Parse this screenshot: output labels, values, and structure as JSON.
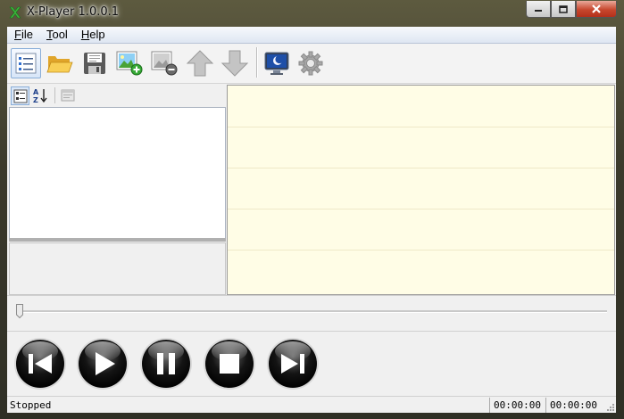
{
  "window": {
    "title": "X-Player 1.0.0.1",
    "minimize_icon": "minimize-icon",
    "maximize_icon": "maximize-icon",
    "close_icon": "close-icon"
  },
  "menu": {
    "items": [
      {
        "accel": "F",
        "rest": "ile"
      },
      {
        "accel": "T",
        "rest": "ool"
      },
      {
        "accel": "H",
        "rest": "elp"
      }
    ]
  },
  "toolbar": {
    "icons": [
      "playlist-icon",
      "open-folder-icon",
      "save-icon",
      "add-image-icon",
      "remove-image-icon",
      "move-up-icon",
      "move-down-icon",
      "display-icon",
      "settings-icon"
    ]
  },
  "left_toolbar": {
    "icons": [
      "categorized-icon",
      "sort-alpha-icon",
      "property-pages-icon"
    ]
  },
  "controls": {
    "icons": [
      "previous-icon",
      "play-icon",
      "pause-icon",
      "stop-icon",
      "next-icon"
    ]
  },
  "seek": {
    "position": 0.0
  },
  "status": {
    "text": "Stopped",
    "elapsed": "00:00:00",
    "total": "00:00:00"
  },
  "colors": {
    "list_bg": "#fffde6",
    "accent": "#8aaed8"
  }
}
